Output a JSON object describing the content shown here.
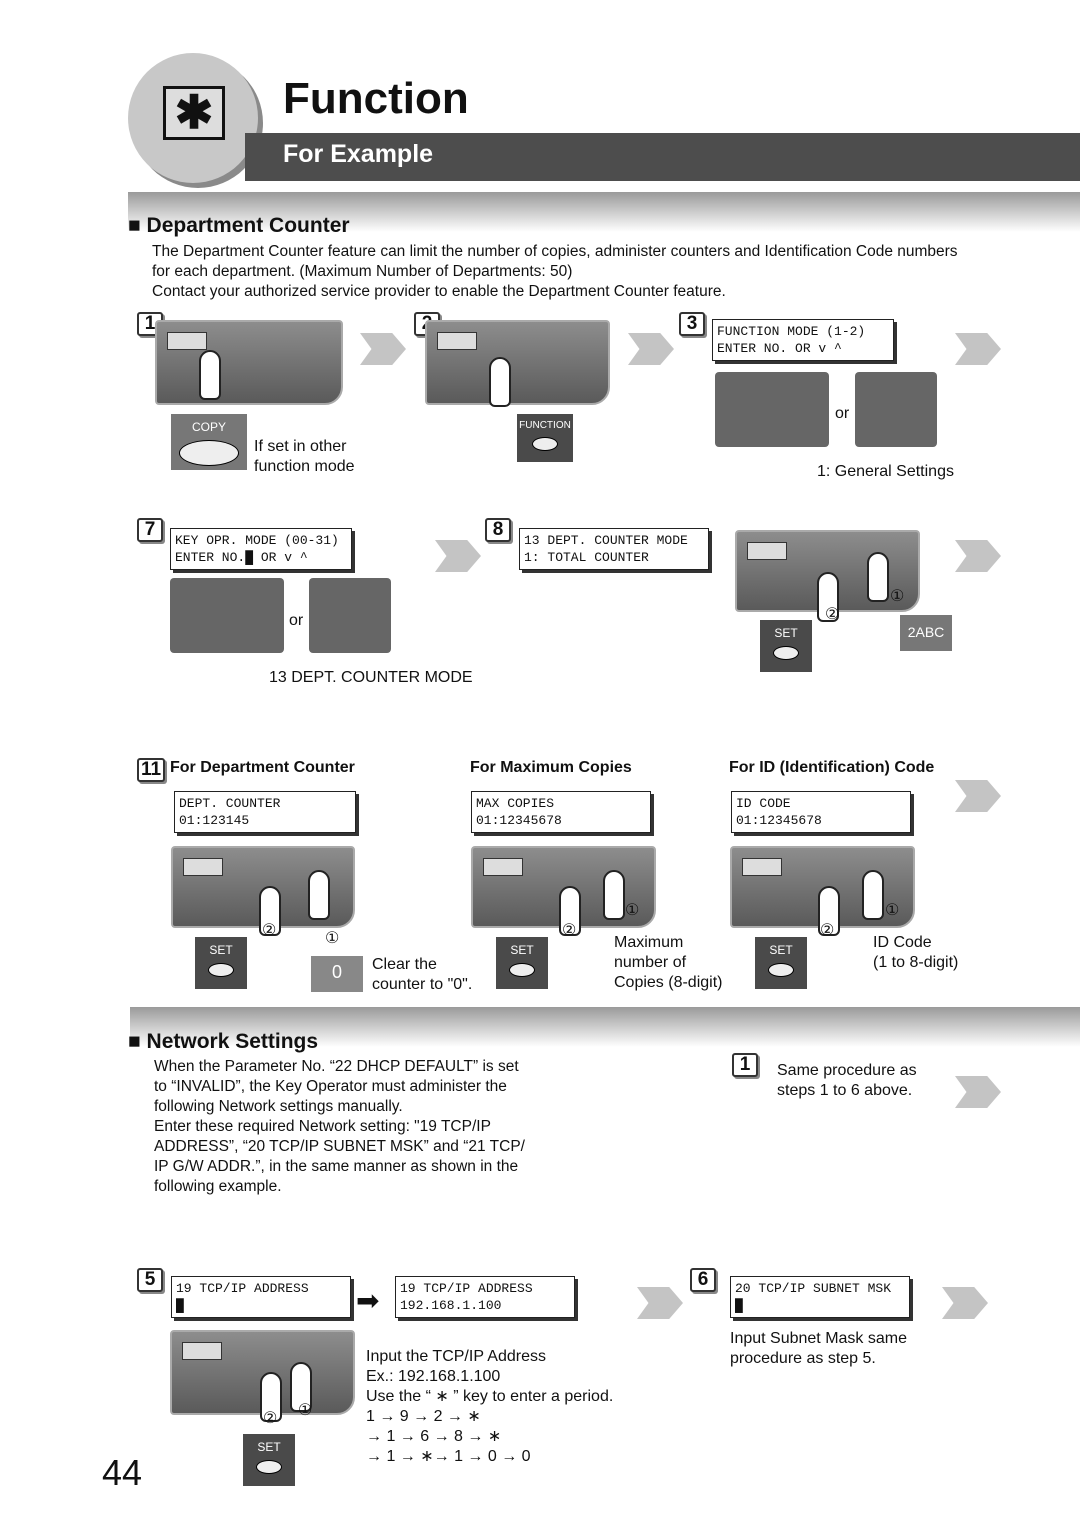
{
  "header": {
    "icon": "asterisk-icon",
    "title": "Function",
    "subtitle": "For Example"
  },
  "dept": {
    "heading": "Department Counter",
    "para": [
      "The Department Counter feature can limit the number of copies, administer counters and Identification Code numbers",
      "for each department. (Maximum Number of Departments: 50)",
      "Contact your authorized service provider to enable the Department Counter feature."
    ],
    "steps": {
      "s1": "1",
      "s2": "2",
      "s3": "3",
      "s7": "7",
      "s8": "8",
      "s11": "11"
    },
    "copy_key": "COPY",
    "copy_note": [
      "If set in other",
      "function mode"
    ],
    "function_key": "FUNCTION",
    "lcd3": [
      "FUNCTION MODE (1-2)",
      "ENTER NO. OR v ^"
    ],
    "or": "or",
    "general": "1: General Settings",
    "lcd7": [
      "KEY OPR. MODE (00-31)",
      "ENTER NO.█ OR v ^"
    ],
    "mode13": "13 DEPT. COUNTER MODE",
    "lcd8": [
      "13 DEPT. COUNTER MODE",
      "1: TOTAL COUNTER"
    ],
    "set": "SET",
    "key2": "2ABC",
    "key0": "0",
    "col1": {
      "title": "For Department Counter",
      "lcd": [
        "DEPT. COUNTER",
        "01:123145"
      ],
      "note": [
        "Clear the",
        "counter to \"0\"."
      ]
    },
    "col2": {
      "title": "For Maximum Copies",
      "lcd": [
        "MAX COPIES",
        "01:12345678"
      ],
      "note": [
        "Maximum",
        "number of",
        "Copies (8-digit)"
      ]
    },
    "col3": {
      "title": "For ID (Identification) Code",
      "lcd": [
        "ID CODE",
        "01:12345678"
      ],
      "note": [
        "ID Code",
        "(1 to 8-digit)"
      ]
    },
    "c1": "①",
    "c2": "②"
  },
  "net": {
    "heading": "Network Settings",
    "para": [
      "When the Parameter No. “22 DHCP DEFAULT” is set",
      "to “INVALID”, the Key Operator must administer the",
      "following Network settings manually.",
      "Enter these required Network setting: \"19 TCP/IP",
      "ADDRESS”, “20 TCP/IP SUBNET MSK” and “21 TCP/",
      "IP G/W ADDR.”, in the same manner as shown in the",
      "following example."
    ],
    "s1": "1",
    "s1_note": [
      "Same procedure as",
      "steps 1 to 6 above."
    ],
    "s5": "5",
    "lcd5a": [
      "19 TCP/IP ADDRESS",
      "█"
    ],
    "lcd5b": [
      "19 TCP/IP ADDRESS",
      "192.168.1.100"
    ],
    "input_note": [
      "Input the TCP/IP Address",
      "Ex.: 192.168.1.100",
      "Use the “ ∗ ” key to enter a period.",
      "1 → 9 → 2 → ∗",
      "→ 1 → 6 → 8 → ∗",
      "→ 1 → ∗→ 1 → 0 → 0"
    ],
    "s6": "6",
    "lcd6": [
      "20 TCP/IP SUBNET MSK",
      "█"
    ],
    "s6_note": [
      "Input Subnet Mask same",
      "procedure as step 5."
    ]
  },
  "page_number": "44"
}
